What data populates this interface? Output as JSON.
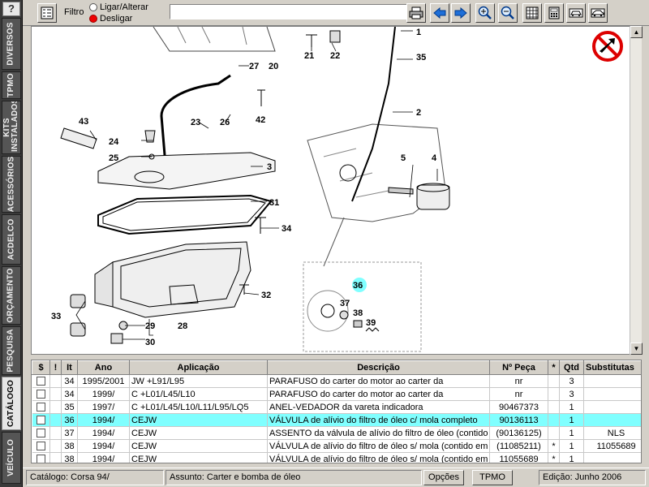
{
  "sidebar": {
    "help": "?",
    "tabs": [
      {
        "label": "DIVERSOS"
      },
      {
        "label": "TPMO"
      },
      {
        "label": "KITS INSTALADOS"
      },
      {
        "label": "ACESSÓRIOS"
      },
      {
        "label": "ACDELCO"
      },
      {
        "label": "ORÇAMENTO"
      },
      {
        "label": "PESQUISA"
      },
      {
        "label": "CATÁLOGO"
      },
      {
        "label": "VEÍCULO"
      }
    ],
    "active": "CATÁLOGO"
  },
  "toolbar": {
    "filter_label": "Filtro",
    "radio_toggle": "Ligar/Alterar",
    "radio_off": "Desligar",
    "filter_value": "",
    "buttons": [
      "printer-icon",
      "arrow-left-icon",
      "arrow-right-icon",
      "zoom-in-icon",
      "zoom-out-icon",
      "grid-icon",
      "calculator-icon",
      "car-front-icon",
      "car-side-icon"
    ]
  },
  "diagram": {
    "labels": [
      "1",
      "2",
      "3",
      "4",
      "5",
      "20",
      "21",
      "22",
      "23",
      "24",
      "25",
      "26",
      "27",
      "28",
      "29",
      "30",
      "31",
      "32",
      "33",
      "34",
      "35",
      "36",
      "37",
      "38",
      "39",
      "42",
      "43"
    ],
    "highlight": "36",
    "no_sign": "no-arrows-icon"
  },
  "table": {
    "columns": [
      "$",
      "!",
      "It",
      "Ano",
      "Aplicação",
      "Descrição",
      "Nº Peça",
      "*",
      "Qtd",
      "Substitutas"
    ],
    "rows": [
      {
        "it": "34",
        "ano": "1995/2001",
        "aplicacao": "JW +L91/L95",
        "descricao": "PARAFUSO do carter do motor ao carter da",
        "peca": "nr",
        "star": "",
        "qtd": "3",
        "subst": ""
      },
      {
        "it": "34",
        "ano": "1999/",
        "aplicacao": "C +L01/L45/L10",
        "descricao": "PARAFUSO do carter do motor ao carter da",
        "peca": "nr",
        "star": "",
        "qtd": "3",
        "subst": ""
      },
      {
        "it": "35",
        "ano": "1997/",
        "aplicacao": "C +L01/L45/L10/L11/L95/LQ5",
        "descricao": "ANEL-VEDADOR da vareta indicadora",
        "peca": "90467373",
        "star": "",
        "qtd": "1",
        "subst": ""
      },
      {
        "it": "36",
        "ano": "1994/",
        "aplicacao": "CEJW",
        "descricao": "VÁLVULA de alívio do filtro de óleo c/ mola completo",
        "peca": "90136113",
        "star": "",
        "qtd": "1",
        "subst": ""
      },
      {
        "it": "37",
        "ano": "1994/",
        "aplicacao": "CEJW",
        "descricao": "ASSENTO da válvula de alívio do filtro de óleo (contido",
        "peca": "(90136125)",
        "star": "",
        "qtd": "1",
        "subst": "NLS"
      },
      {
        "it": "38",
        "ano": "1994/",
        "aplicacao": "CEJW",
        "descricao": "VÁLVULA de alívio do filtro de óleo s/ mola (contido em",
        "peca": "(11085211)",
        "star": "*",
        "qtd": "1",
        "subst": "11055689"
      },
      {
        "it": "38",
        "ano": "1994/",
        "aplicacao": "CEJW",
        "descricao": "VÁLVULA de alívio do filtro de óleo s/ mola (contido em",
        "peca": "11055689",
        "star": "*",
        "qtd": "1",
        "subst": ""
      }
    ],
    "selected_index": 3
  },
  "status": {
    "catalogo": "Catálogo: Corsa 94/",
    "assunto": "Assunto: Carter e bomba de óleo",
    "opcoes": "Opções",
    "tpmo": "TPMO",
    "edicao": "Edição: Junho 2006"
  }
}
